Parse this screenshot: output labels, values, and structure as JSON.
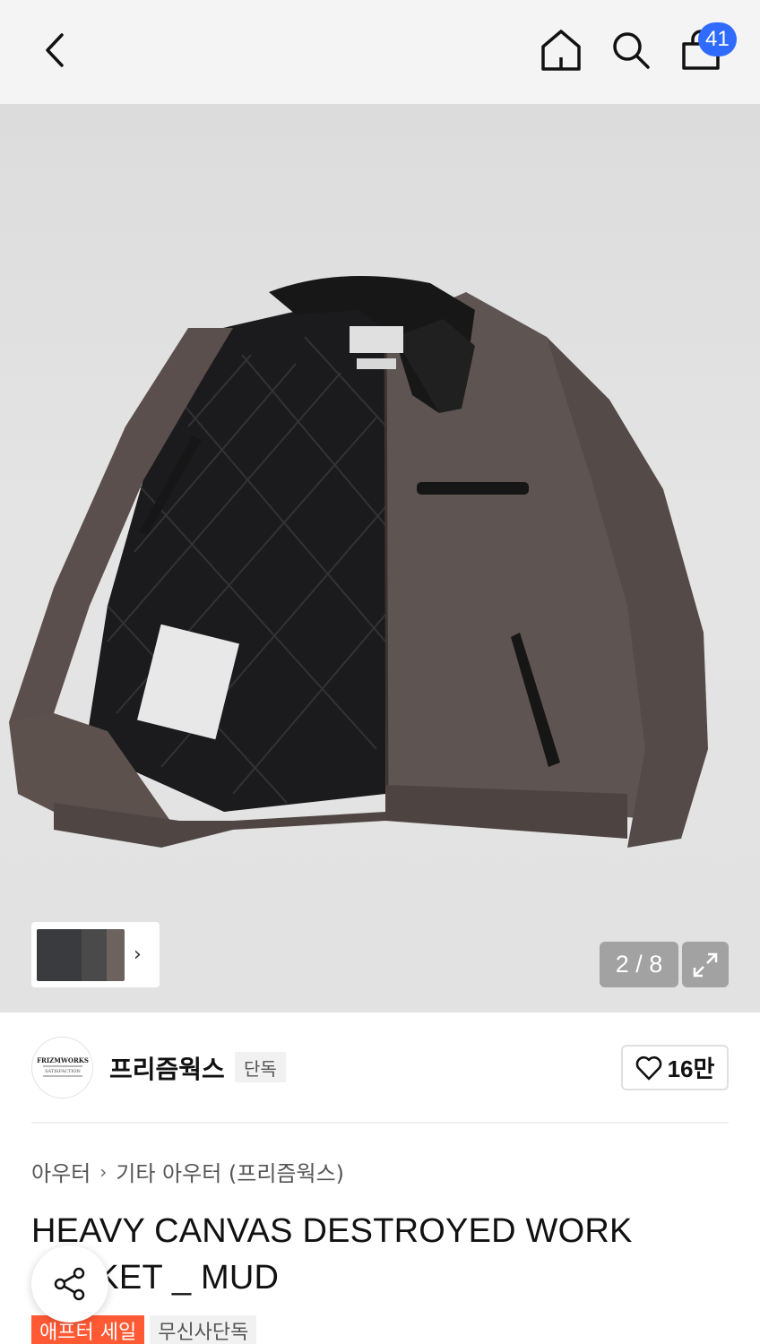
{
  "header": {
    "cart_count": "41",
    "icons": [
      "chevron-left-icon",
      "home-icon",
      "search-icon",
      "shopping-bag-icon"
    ]
  },
  "gallery": {
    "counter": "2 / 8",
    "current_image": 2,
    "total_images": 8
  },
  "brand": {
    "name": "프리즘웍스",
    "tag": "단독",
    "logo_text": "FRIZMWORKS",
    "logo_subtext": "SATISFACTION",
    "like_count": "16만"
  },
  "breadcrumb": {
    "level1": "아우터",
    "level2": "기타 아우터 (프리즘웍스)"
  },
  "product": {
    "title": "HEAVY CANVAS DESTROYED WORK JACKET _ MUD"
  },
  "tags": {
    "sale": "애프터 세일",
    "exclusive": "무신사단독"
  },
  "colors": {
    "accent_blue": "#2f6bff",
    "sale_red": "#ff5a34"
  }
}
